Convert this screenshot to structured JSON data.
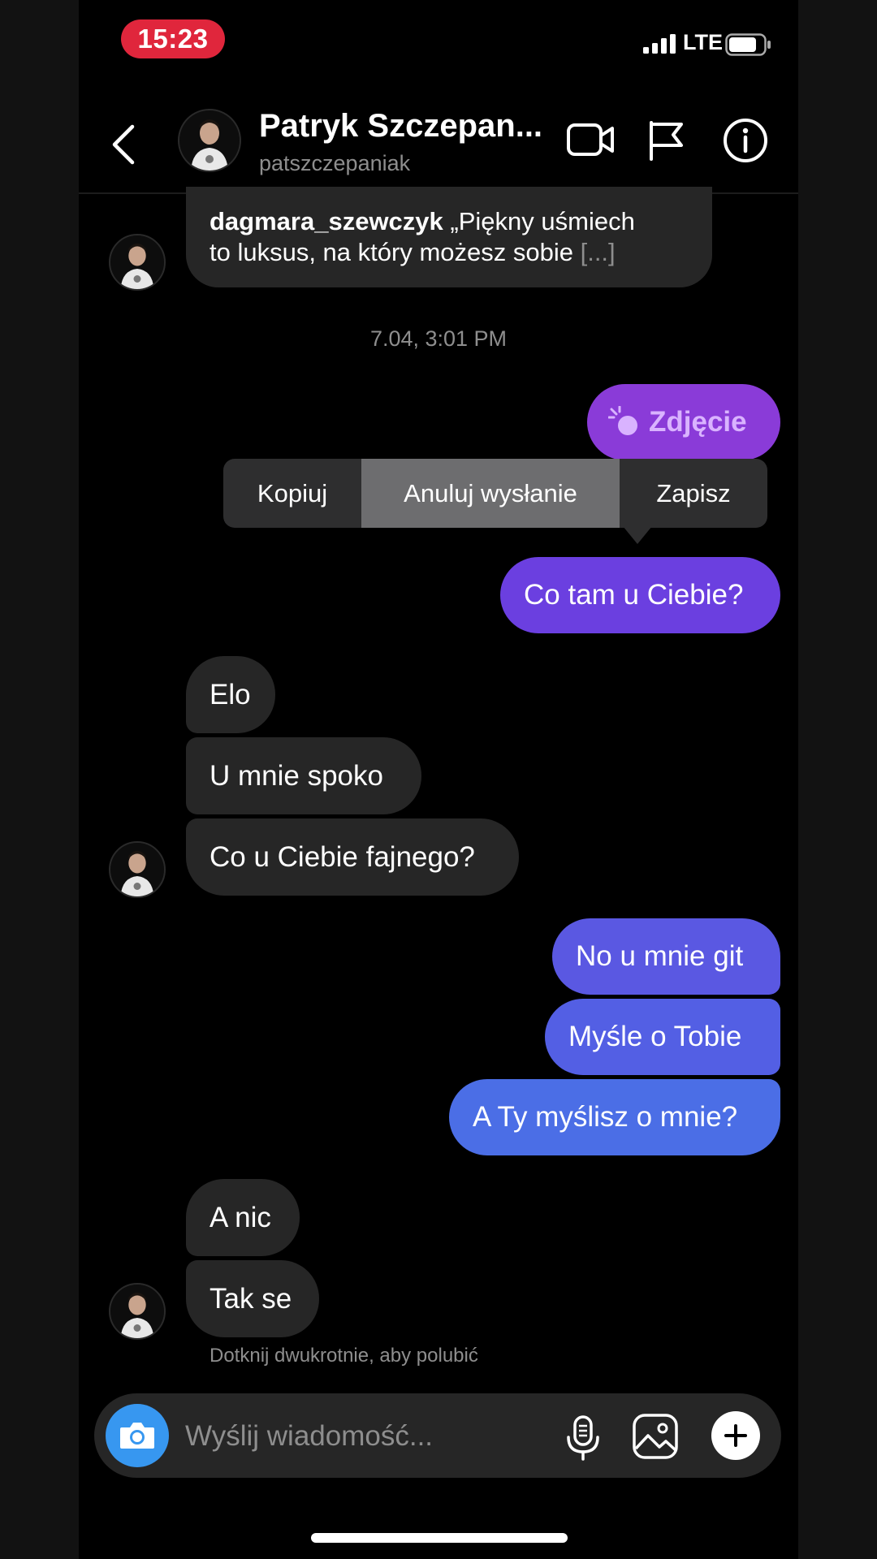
{
  "status": {
    "time": "15:23",
    "network": "LTE"
  },
  "header": {
    "name": "Patryk Szczepan...",
    "username": "patszczepaniak"
  },
  "shared_post": {
    "author": "dagmara_szewczyk",
    "text": " „Piękny uśmiech",
    "text2": "to luksus, na który możesz sobie",
    "ellipsis": " [...]"
  },
  "timestamp": "7.04, 3:01 PM",
  "photo_message": "Zdjęcie",
  "menu": {
    "copy": "Kopiuj",
    "unsend": "Anuluj wysłanie",
    "save": "Zapisz"
  },
  "messages": {
    "out1": "Co tam u Ciebie?",
    "in1": "Elo",
    "in2": "U mnie spoko",
    "in3": "Co u Ciebie fajnego?",
    "out2": "No u mnie git",
    "out3": "Myśle o Tobie",
    "out4": "A Ty myślisz o mnie?",
    "in4": "A nic",
    "in5": "Tak se"
  },
  "hint": "Dotknij dwukrotnie, aby polubić",
  "composer": {
    "placeholder": "Wyślij wiadomość..."
  },
  "colors": {
    "purple": "#8a3bd8",
    "violet": "#6b3fe0",
    "indigo": "#5a58e2",
    "blue": "#4b6ee6",
    "camera": "#3797f0",
    "incoming": "#262626"
  },
  "icons": [
    "back-icon",
    "video-icon",
    "flag-icon",
    "info-icon",
    "camera-icon",
    "microphone-icon",
    "gallery-icon",
    "plus-icon",
    "photo-icon",
    "signal-icon",
    "battery-icon"
  ]
}
